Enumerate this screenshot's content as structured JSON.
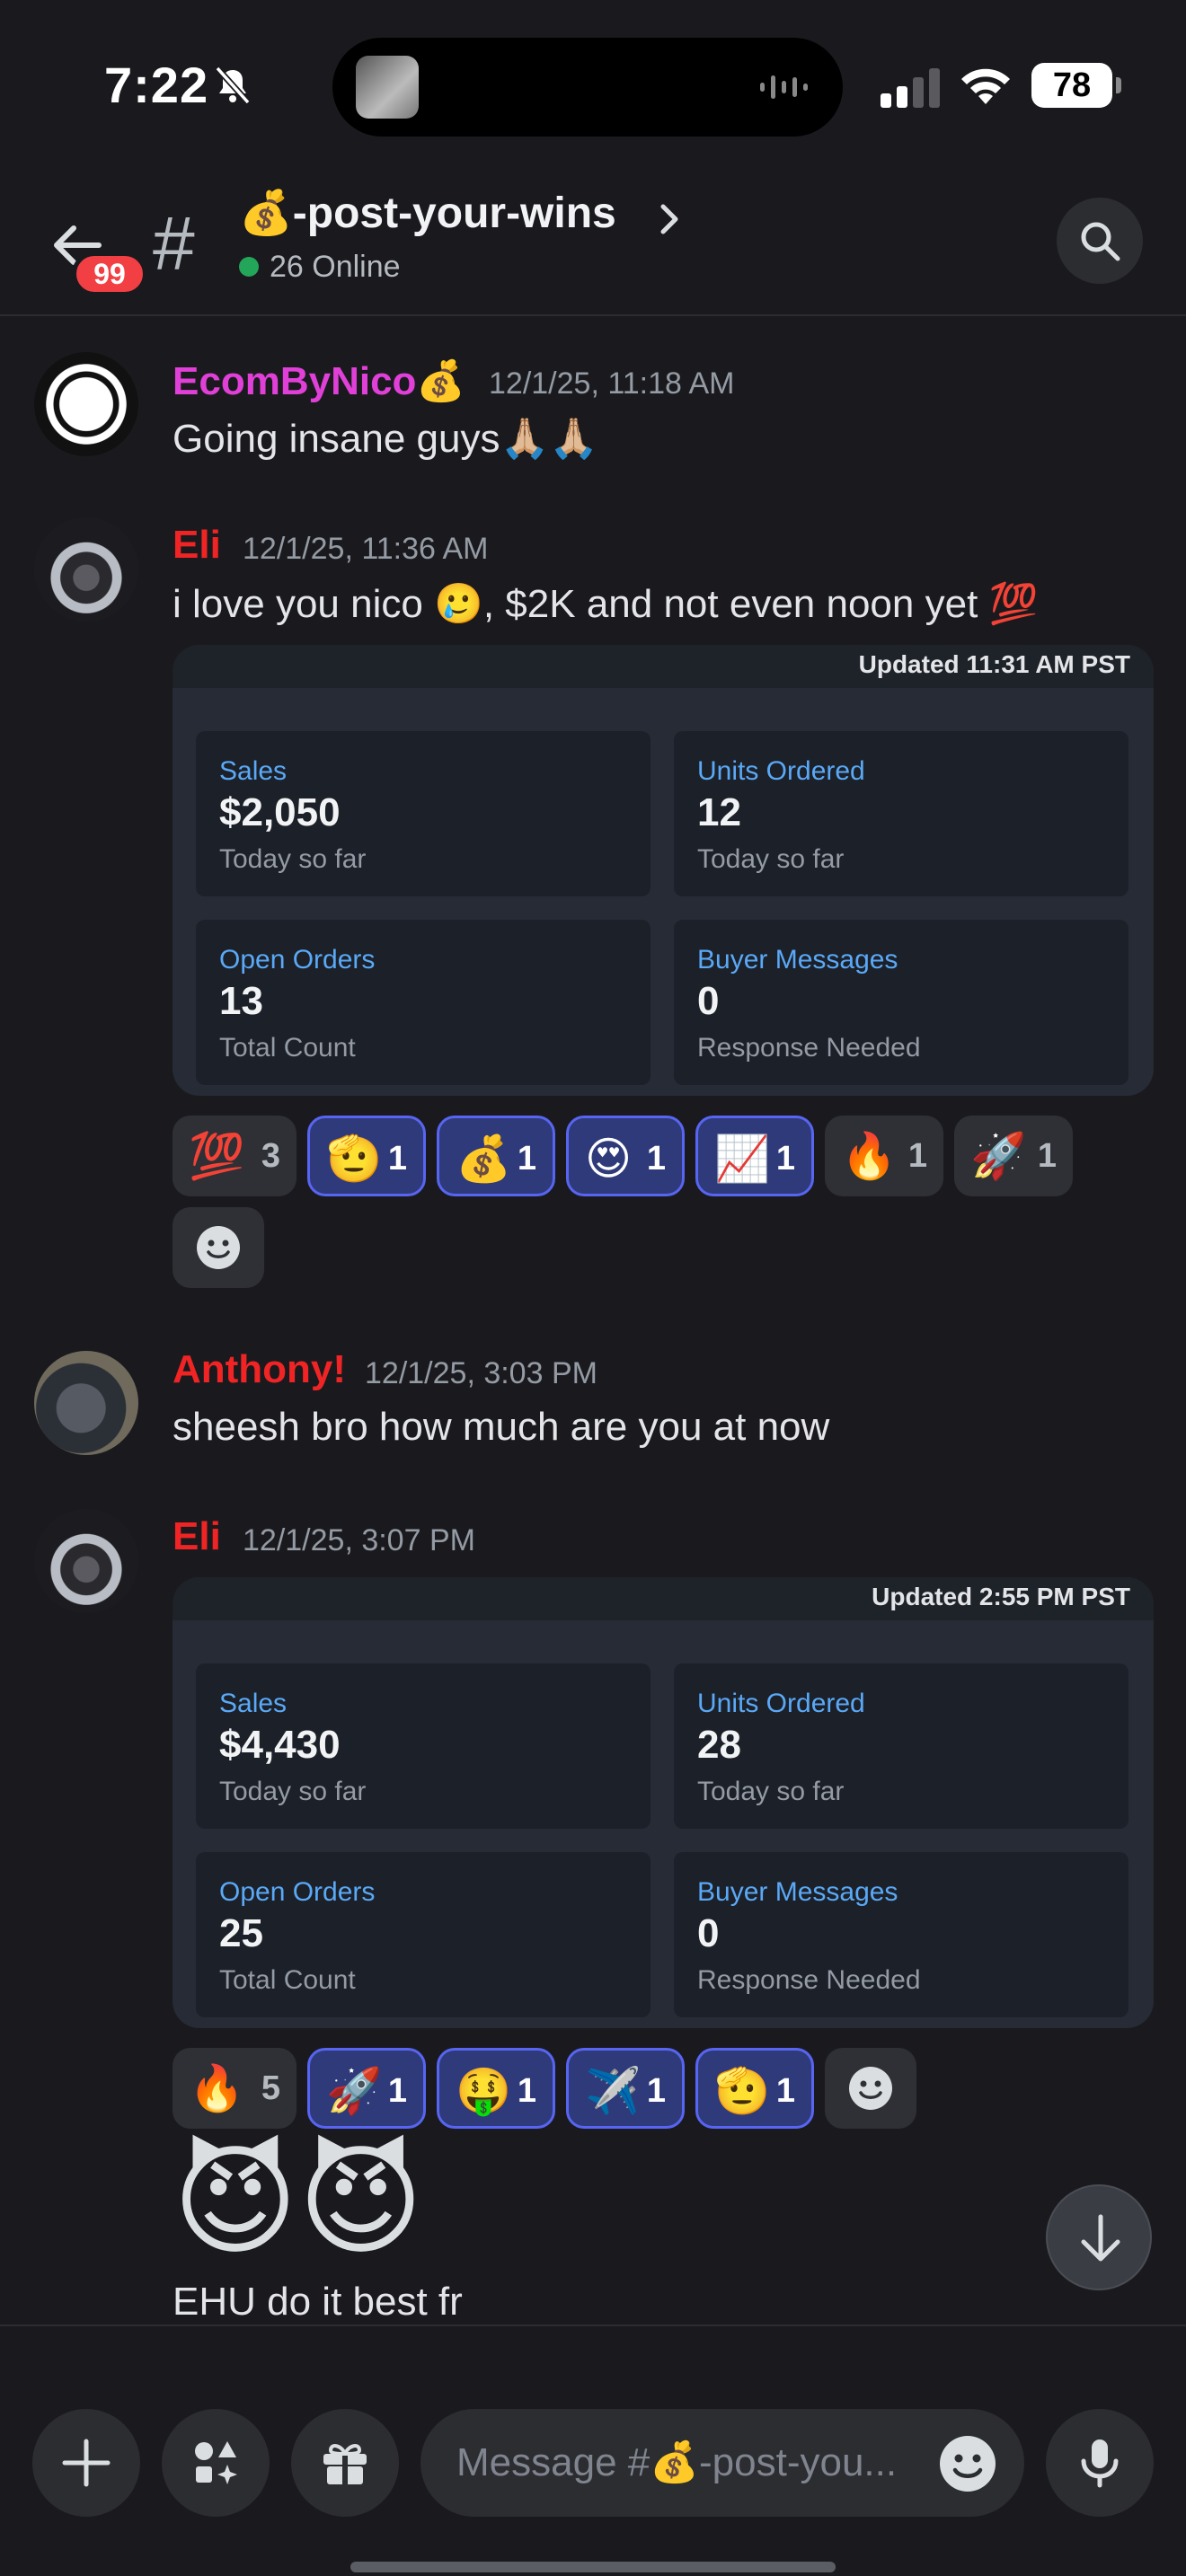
{
  "status_bar": {
    "time": "7:22",
    "battery": "78"
  },
  "header": {
    "unread_count": "99",
    "channel_icon": "💰",
    "channel_name": "-post-your-wins",
    "online": "26 Online"
  },
  "messages": [
    {
      "author": "EcomByNico",
      "author_badge": "💰",
      "timestamp": "12/1/25, 11:18 AM",
      "text": "Going insane guys",
      "text_emoji": "🙏🏼🙏🏼"
    },
    {
      "author": "Eli",
      "timestamp": "12/1/25, 11:36 AM",
      "text_a": "i love you nico ",
      "emoji_a": "🥲",
      "text_b": ", $2K and not even noon yet ",
      "emoji_b": "💯",
      "embed": {
        "updated": "Updated 11:31 AM PST",
        "tiles": [
          {
            "label": "Sales",
            "value": "$2,050",
            "sub": "Today so far"
          },
          {
            "label": "Units Ordered",
            "value": "12",
            "sub": "Today so far"
          },
          {
            "label": "Open Orders",
            "value": "13",
            "sub": "Total Count"
          },
          {
            "label": "Buyer Messages",
            "value": "0",
            "sub": "Response Needed"
          }
        ]
      },
      "reactions": [
        {
          "emoji": "💯",
          "count": "3",
          "me": false
        },
        {
          "emoji": "🫡",
          "count": "1",
          "me": true
        },
        {
          "emoji": "💰",
          "count": "1",
          "me": true
        },
        {
          "emoji": "😍",
          "count": "1",
          "me": true
        },
        {
          "emoji": "📈",
          "count": "1",
          "me": true
        },
        {
          "emoji": "🔥",
          "count": "1",
          "me": false
        },
        {
          "emoji": "🚀",
          "count": "1",
          "me": false
        }
      ]
    },
    {
      "author": "Anthony!",
      "timestamp": "12/1/25, 3:03 PM",
      "text": "sheesh bro how much are you at now"
    },
    {
      "author": "Eli",
      "timestamp": "12/1/25, 3:07 PM",
      "embed": {
        "updated": "Updated 2:55 PM PST",
        "tiles": [
          {
            "label": "Sales",
            "value": "$4,430",
            "sub": "Today so far"
          },
          {
            "label": "Units Ordered",
            "value": "28",
            "sub": "Today so far"
          },
          {
            "label": "Open Orders",
            "value": "25",
            "sub": "Total Count"
          },
          {
            "label": "Buyer Messages",
            "value": "0",
            "sub": "Response Needed"
          }
        ]
      },
      "reactions": [
        {
          "emoji": "🔥",
          "count": "5",
          "me": false
        },
        {
          "emoji": "🚀",
          "count": "1",
          "me": true
        },
        {
          "emoji": "🤑",
          "count": "1",
          "me": true
        },
        {
          "emoji": "✈️",
          "count": "1",
          "me": true
        },
        {
          "emoji": "🫡",
          "count": "1",
          "me": true
        }
      ],
      "big_emoji": "😈😈",
      "text": "EHU do it best fr"
    }
  ],
  "composer": {
    "placeholder": "Message #💰-post-you..."
  },
  "colors": {
    "background": "#1a1a1e",
    "author_magenta": "#e040d8",
    "author_red": "#f02424",
    "tile_label_blue": "#5aa9f7",
    "online_green": "#23a55a",
    "badge_red": "#f23f43",
    "reaction_active": "#5865f2"
  },
  "icons": {
    "back": "arrow-left-icon",
    "channel": "hash-icon",
    "search": "search-icon",
    "add": "plus-icon",
    "apps": "apps-icon",
    "gift": "gift-icon",
    "emoji": "smiley-icon",
    "mic": "microphone-icon",
    "scroll": "arrow-down-icon"
  }
}
